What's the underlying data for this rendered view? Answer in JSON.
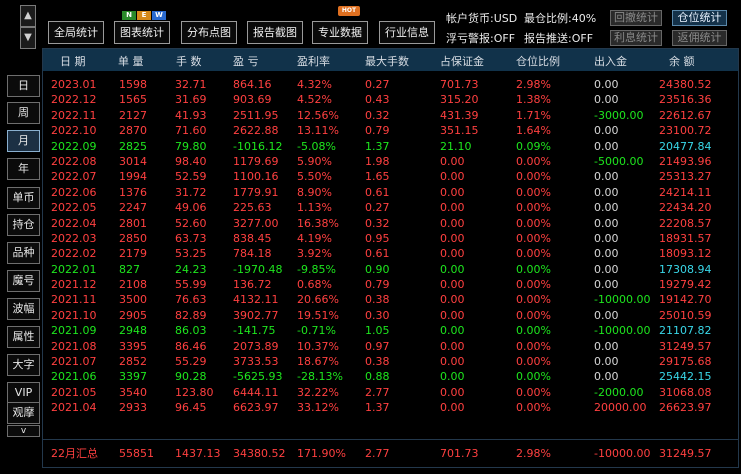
{
  "nav": {
    "up_arrow": "▲",
    "down_arrow": "▼",
    "more_arrow": "v",
    "periods": [
      "日",
      "周",
      "月",
      "年"
    ],
    "active_period": "月",
    "tools": [
      "单币",
      "持仓",
      "品种",
      "魔号",
      "波幅",
      "属性",
      "大字",
      "VIP",
      "观摩"
    ]
  },
  "toolbar": {
    "buttons": [
      "全局统计",
      "图表统计",
      "分布点图",
      "报告截图",
      "专业数据",
      "行业信息"
    ],
    "new_badge": [
      "N",
      "E",
      "W"
    ],
    "hot_badge": "HOT",
    "account_currency": "帐户货币:USD",
    "max_ratio": "最仓比例:40%",
    "floating_alert": "浮亏警报:OFF",
    "report_push": "报告推送:OFF",
    "right_buttons": [
      "回撤统计",
      "仓位统计",
      "利息统计",
      "返佣统计"
    ],
    "active_right_button": "仓位统计"
  },
  "table": {
    "headers": [
      "日 期",
      "单 量",
      "手 数",
      "盈 亏",
      "盈利率",
      "最大手数",
      "占保证金",
      "仓位比例",
      "出入金",
      "余 额"
    ],
    "rows": [
      {
        "date": "2023.01",
        "orders": "1598",
        "lots": "32.71",
        "pnl": "864.16",
        "rate": "4.32%",
        "max_lots": "0.27",
        "margin": "701.73",
        "position_ratio": "2.98%",
        "flow": "0.00",
        "balance": "24380.52",
        "tone": "red"
      },
      {
        "date": "2022.12",
        "orders": "1565",
        "lots": "31.69",
        "pnl": "903.69",
        "rate": "4.52%",
        "max_lots": "0.43",
        "margin": "315.20",
        "position_ratio": "1.38%",
        "flow": "0.00",
        "balance": "23516.36",
        "tone": "red"
      },
      {
        "date": "2022.11",
        "orders": "2127",
        "lots": "41.93",
        "pnl": "2511.95",
        "rate": "12.56%",
        "max_lots": "0.32",
        "margin": "431.39",
        "position_ratio": "1.71%",
        "flow": "-3000.00",
        "balance": "22612.67",
        "tone": "red"
      },
      {
        "date": "2022.10",
        "orders": "2870",
        "lots": "71.60",
        "pnl": "2622.88",
        "rate": "13.11%",
        "max_lots": "0.79",
        "margin": "351.15",
        "position_ratio": "1.64%",
        "flow": "0.00",
        "balance": "23100.72",
        "tone": "red"
      },
      {
        "date": "2022.09",
        "orders": "2825",
        "lots": "79.80",
        "pnl": "-1016.12",
        "rate": "-5.08%",
        "max_lots": "1.37",
        "margin": "21.10",
        "position_ratio": "0.09%",
        "flow": "0.00",
        "balance": "20477.84",
        "tone": "green"
      },
      {
        "date": "2022.08",
        "orders": "3014",
        "lots": "98.40",
        "pnl": "1179.69",
        "rate": "5.90%",
        "max_lots": "1.98",
        "margin": "0.00",
        "position_ratio": "0.00%",
        "flow": "-5000.00",
        "balance": "21493.96",
        "tone": "red"
      },
      {
        "date": "2022.07",
        "orders": "1994",
        "lots": "52.59",
        "pnl": "1100.16",
        "rate": "5.50%",
        "max_lots": "1.65",
        "margin": "0.00",
        "position_ratio": "0.00%",
        "flow": "0.00",
        "balance": "25313.27",
        "tone": "red"
      },
      {
        "date": "2022.06",
        "orders": "1376",
        "lots": "31.72",
        "pnl": "1779.91",
        "rate": "8.90%",
        "max_lots": "0.61",
        "margin": "0.00",
        "position_ratio": "0.00%",
        "flow": "0.00",
        "balance": "24214.11",
        "tone": "red"
      },
      {
        "date": "2022.05",
        "orders": "2247",
        "lots": "49.06",
        "pnl": "225.63",
        "rate": "1.13%",
        "max_lots": "0.27",
        "margin": "0.00",
        "position_ratio": "0.00%",
        "flow": "0.00",
        "balance": "22434.20",
        "tone": "red"
      },
      {
        "date": "2022.04",
        "orders": "2801",
        "lots": "52.60",
        "pnl": "3277.00",
        "rate": "16.38%",
        "max_lots": "0.32",
        "margin": "0.00",
        "position_ratio": "0.00%",
        "flow": "0.00",
        "balance": "22208.57",
        "tone": "red"
      },
      {
        "date": "2022.03",
        "orders": "2850",
        "lots": "63.73",
        "pnl": "838.45",
        "rate": "4.19%",
        "max_lots": "0.95",
        "margin": "0.00",
        "position_ratio": "0.00%",
        "flow": "0.00",
        "balance": "18931.57",
        "tone": "red"
      },
      {
        "date": "2022.02",
        "orders": "2179",
        "lots": "53.25",
        "pnl": "784.18",
        "rate": "3.92%",
        "max_lots": "0.61",
        "margin": "0.00",
        "position_ratio": "0.00%",
        "flow": "0.00",
        "balance": "18093.12",
        "tone": "red"
      },
      {
        "date": "2022.01",
        "orders": "827",
        "lots": "24.23",
        "pnl": "-1970.48",
        "rate": "-9.85%",
        "max_lots": "0.90",
        "margin": "0.00",
        "position_ratio": "0.00%",
        "flow": "0.00",
        "balance": "17308.94",
        "tone": "green"
      },
      {
        "date": "2021.12",
        "orders": "2108",
        "lots": "55.99",
        "pnl": "136.72",
        "rate": "0.68%",
        "max_lots": "0.79",
        "margin": "0.00",
        "position_ratio": "0.00%",
        "flow": "0.00",
        "balance": "19279.42",
        "tone": "red"
      },
      {
        "date": "2021.11",
        "orders": "3500",
        "lots": "76.63",
        "pnl": "4132.11",
        "rate": "20.66%",
        "max_lots": "0.38",
        "margin": "0.00",
        "position_ratio": "0.00%",
        "flow": "-10000.00",
        "balance": "19142.70",
        "tone": "red"
      },
      {
        "date": "2021.10",
        "orders": "2905",
        "lots": "82.89",
        "pnl": "3902.77",
        "rate": "19.51%",
        "max_lots": "0.30",
        "margin": "0.00",
        "position_ratio": "0.00%",
        "flow": "0.00",
        "balance": "25010.59",
        "tone": "red"
      },
      {
        "date": "2021.09",
        "orders": "2948",
        "lots": "86.03",
        "pnl": "-141.75",
        "rate": "-0.71%",
        "max_lots": "1.05",
        "margin": "0.00",
        "position_ratio": "0.00%",
        "flow": "-10000.00",
        "balance": "21107.82",
        "tone": "green"
      },
      {
        "date": "2021.08",
        "orders": "3395",
        "lots": "86.46",
        "pnl": "2073.89",
        "rate": "10.37%",
        "max_lots": "0.97",
        "margin": "0.00",
        "position_ratio": "0.00%",
        "flow": "0.00",
        "balance": "31249.57",
        "tone": "red"
      },
      {
        "date": "2021.07",
        "orders": "2852",
        "lots": "55.29",
        "pnl": "3733.53",
        "rate": "18.67%",
        "max_lots": "0.38",
        "margin": "0.00",
        "position_ratio": "0.00%",
        "flow": "0.00",
        "balance": "29175.68",
        "tone": "red"
      },
      {
        "date": "2021.06",
        "orders": "3397",
        "lots": "90.28",
        "pnl": "-5625.93",
        "rate": "-28.13%",
        "max_lots": "0.88",
        "margin": "0.00",
        "position_ratio": "0.00%",
        "flow": "0.00",
        "balance": "25442.15",
        "tone": "green"
      },
      {
        "date": "2021.05",
        "orders": "3540",
        "lots": "123.80",
        "pnl": "6444.11",
        "rate": "32.22%",
        "max_lots": "2.77",
        "margin": "0.00",
        "position_ratio": "0.00%",
        "flow": "-2000.00",
        "balance": "31068.08",
        "tone": "red"
      },
      {
        "date": "2021.04",
        "orders": "2933",
        "lots": "96.45",
        "pnl": "6623.97",
        "rate": "33.12%",
        "max_lots": "1.37",
        "margin": "0.00",
        "position_ratio": "0.00%",
        "flow": "20000.00",
        "balance": "26623.97",
        "tone": "red"
      }
    ],
    "summary": {
      "date": "22月汇总",
      "orders": "55851",
      "lots": "1437.13",
      "pnl": "34380.52",
      "rate": "171.90%",
      "max_lots": "2.77",
      "margin": "701.73",
      "position_ratio": "2.98%",
      "flow": "-10000.00",
      "balance": "31249.57"
    }
  },
  "colors": {
    "profit": "#ff4040",
    "loss": "#1ee61e",
    "neutral": "#d6d6d6",
    "header_bg": "#11324a",
    "accent": "#39d7e8"
  }
}
